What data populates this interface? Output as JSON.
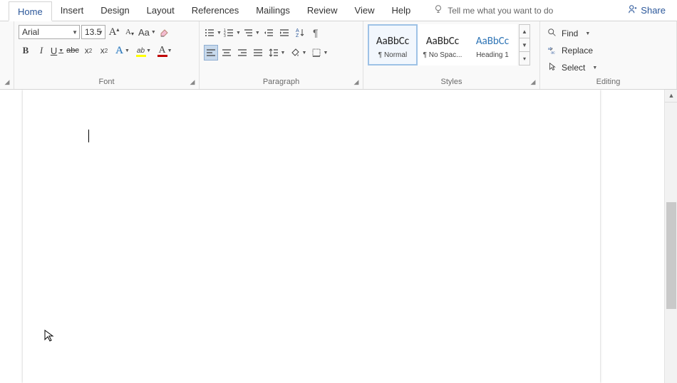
{
  "tabs": {
    "home": "Home",
    "insert": "Insert",
    "design": "Design",
    "layout": "Layout",
    "references": "References",
    "mailings": "Mailings",
    "review": "Review",
    "view": "View",
    "help": "Help"
  },
  "tell_me": "Tell me what you want to do",
  "share": "Share",
  "font_group": {
    "label": "Font",
    "font_name": "Arial",
    "font_size": "13.5",
    "bold": "B",
    "italic": "I",
    "underline": "U",
    "strike": "abc",
    "subscript": "x",
    "subscript_sub": "2",
    "superscript": "x",
    "superscript_sup": "2",
    "case": "Aa",
    "grow": "A",
    "shrink": "A",
    "font_color_letter": "A",
    "highlight_glyph": "ab"
  },
  "paragraph_group": {
    "label": "Paragraph"
  },
  "styles_group": {
    "label": "Styles",
    "preview_text": "AaBbCc",
    "items": [
      {
        "name": "¶ Normal"
      },
      {
        "name": "¶ No Spac..."
      },
      {
        "name": "Heading 1"
      }
    ]
  },
  "editing_group": {
    "label": "Editing",
    "find": "Find",
    "replace": "Replace",
    "select": "Select"
  }
}
